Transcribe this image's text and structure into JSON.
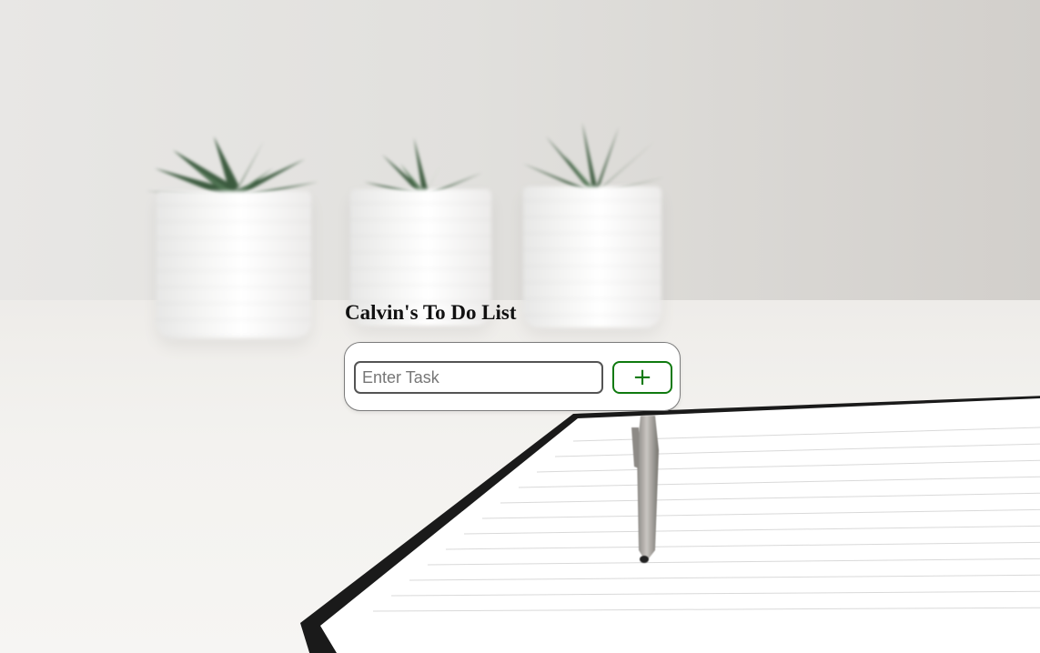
{
  "header": {
    "title": "Calvin's To Do List"
  },
  "task_form": {
    "input_value": "",
    "input_placeholder": "Enter Task",
    "add_label": "+"
  },
  "colors": {
    "accent": "#0f7a0f",
    "input_border": "#545454",
    "card_background": "#ffffff"
  },
  "icons": {
    "add_button_icon": "plus-icon"
  }
}
